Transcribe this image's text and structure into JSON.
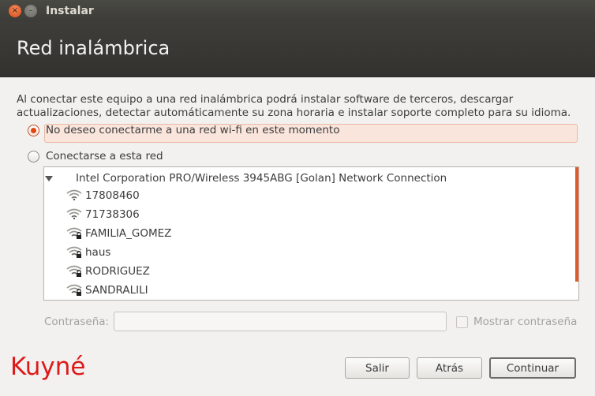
{
  "window": {
    "title": "Instalar",
    "close_glyph": "×",
    "minimize_glyph": "–"
  },
  "header": {
    "title": "Red inalámbrica"
  },
  "description": "Al conectar este equipo a una red inalámbrica podrá instalar software de terceros, descargar actualizaciones, detectar automáticamente su zona horaria e instalar soporte completo para su idioma.",
  "options": {
    "no_wifi": {
      "label": "No deseo conectarme a una red wi-fi en este momento",
      "selected": true
    },
    "connect": {
      "label": "Conectarse a esta red",
      "selected": false
    }
  },
  "network_list": {
    "adapter": "Intel Corporation PRO/Wireless 3945ABG [Golan] Network Connection",
    "networks": [
      {
        "name": "17808460",
        "secured": false,
        "icon": "wifi-signal-icon"
      },
      {
        "name": "71738306",
        "secured": false,
        "icon": "wifi-signal-icon"
      },
      {
        "name": "FAMILIA_GOMEZ",
        "secured": true,
        "icon": "wifi-secure-icon"
      },
      {
        "name": "haus",
        "secured": true,
        "icon": "wifi-secure-icon"
      },
      {
        "name": "RODRIGUEZ",
        "secured": true,
        "icon": "wifi-secure-icon"
      },
      {
        "name": "SANDRALILI",
        "secured": true,
        "icon": "wifi-secure-icon"
      }
    ]
  },
  "password": {
    "label": "Contraseña:",
    "value": "",
    "placeholder": ""
  },
  "show_password": {
    "label": "Mostrar contraseña",
    "checked": false
  },
  "brand": "Kuyné",
  "buttons": {
    "quit": "Salir",
    "back": "Atrás",
    "continue": "Continuar"
  },
  "colors": {
    "accent": "#dd4814",
    "brand": "#dd1a1a",
    "header_bg": "#3c3b37"
  }
}
